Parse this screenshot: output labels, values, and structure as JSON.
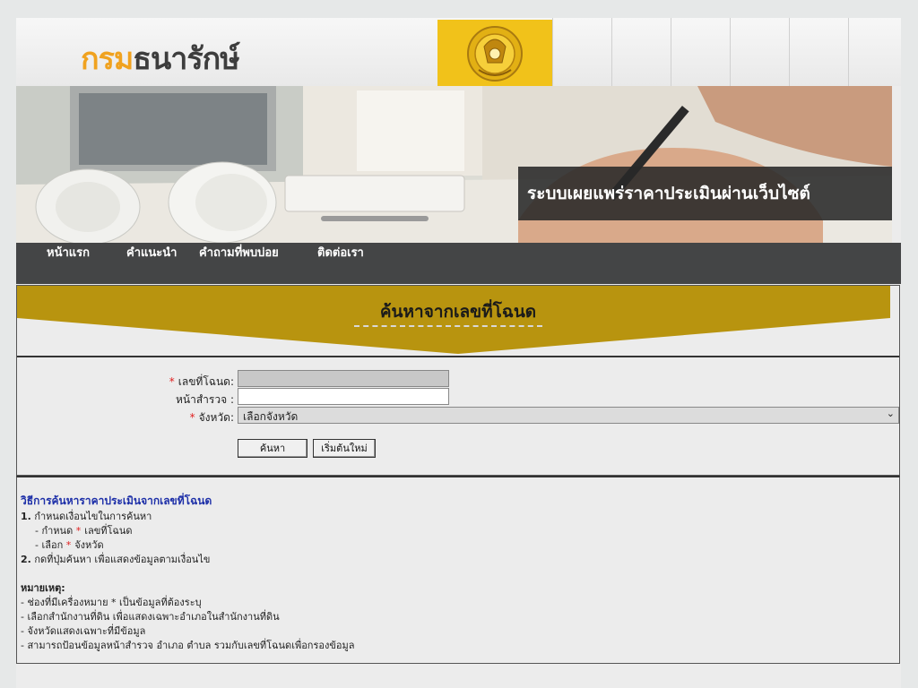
{
  "header": {
    "logo_part1": "กรม",
    "logo_part2": "ธนารักษ์",
    "seal": "department-seal"
  },
  "banner": {
    "caption": "ระบบเผยแพร่ราคาประเมินผ่านเว็บไซต์"
  },
  "nav": {
    "items": [
      "หน้าแรก",
      "คำแนะนำ",
      "คำถามที่พบบ่อย",
      "ติดต่อเรา"
    ]
  },
  "search": {
    "title": "ค้นหาจากเลขที่โฉนด",
    "required_mark": "*",
    "deed_label": "เลขที่โฉนด:",
    "deed_value": "",
    "survey_label": "หน้าสำรวจ :",
    "survey_value": "",
    "province_label": "จังหวัด:",
    "province_selected": "เลือกจังหวัด",
    "search_button": "ค้นหา",
    "reset_button": "เริ่มต้นใหม่"
  },
  "instructions": {
    "title": "วิธีการค้นหาราคาประเมินจากเลขที่โฉนด",
    "step1_num": "1.",
    "step1": "กำหนดเงื่อนไขในการค้นหา",
    "sub1_pre": "- กำหนด",
    "sub1_post": "เลขที่โฉนด",
    "sub2_pre": "- เลือก",
    "sub2_post": "จังหวัด",
    "step2_num": "2.",
    "step2": "กดที่ปุ่มค้นหา เพื่อแสดงข้อมูลตามเงื่อนไข",
    "note_title": "หมายเหตุ:",
    "notes": [
      "- ช่องที่มีเครื่องหมาย * เป็นข้อมูลที่ต้องระบุ",
      "- เลือกสำนักงานที่ดิน เพื่อแสดงเฉพาะอำเภอในสำนักงานที่ดิน",
      "- จังหวัดแสดงเฉพาะที่มีข้อมูล",
      "- สามารถป้อนข้อมูลหน้าสำรวจ อำเภอ ตำบล รวมกับเลขที่โฉนดเพื่อกรองข้อมูล"
    ]
  },
  "colors": {
    "accent_gold": "#b8940f",
    "logo_orange": "#f0a21f",
    "nav_bg": "#444546",
    "instruction_title": "#1d2fa8",
    "required": "#e02020"
  }
}
